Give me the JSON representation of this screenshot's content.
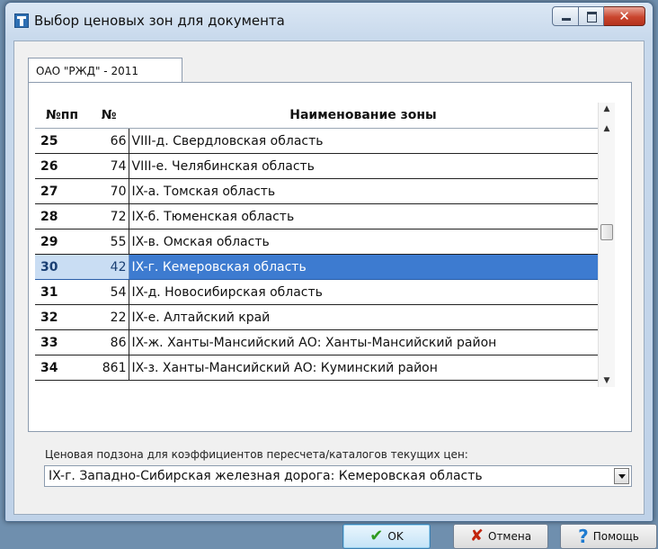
{
  "window": {
    "title": "Выбор ценовых зон для документа"
  },
  "tab": {
    "label": "ОАО \"РЖД\" - 2011"
  },
  "grid": {
    "columns": [
      "№пп",
      "№",
      "Наименование зоны"
    ],
    "rows": [
      {
        "npp": "25",
        "num": "66",
        "name": "VIII-д. Свердловская область"
      },
      {
        "npp": "26",
        "num": "74",
        "name": "VIII-е. Челябинская область"
      },
      {
        "npp": "27",
        "num": "70",
        "name": "IX-а. Томская область"
      },
      {
        "npp": "28",
        "num": "72",
        "name": "IX-б. Тюменская область"
      },
      {
        "npp": "29",
        "num": "55",
        "name": "IX-в. Омская область"
      },
      {
        "npp": "30",
        "num": "42",
        "name": "IX-г. Кемеровская область"
      },
      {
        "npp": "31",
        "num": "54",
        "name": "IX-д. Новосибирская область"
      },
      {
        "npp": "32",
        "num": "22",
        "name": "IX-е. Алтайский край"
      },
      {
        "npp": "33",
        "num": "86",
        "name": "IX-ж. Ханты-Мансийский АО: Ханты-Мансийский район"
      },
      {
        "npp": "34",
        "num": "861",
        "name": "IX-з. Ханты-Мансийский АО: Куминский район"
      }
    ],
    "selected_npp": "30"
  },
  "subzone": {
    "label": "Ценовая подзона для коэффициентов пересчета/каталогов текущих цен:",
    "value": "IX-г. Западно-Сибирская железная дорога: Кемеровская область"
  },
  "buttons": {
    "ok": "OK",
    "cancel": "Отмена",
    "help": "Помощь"
  }
}
